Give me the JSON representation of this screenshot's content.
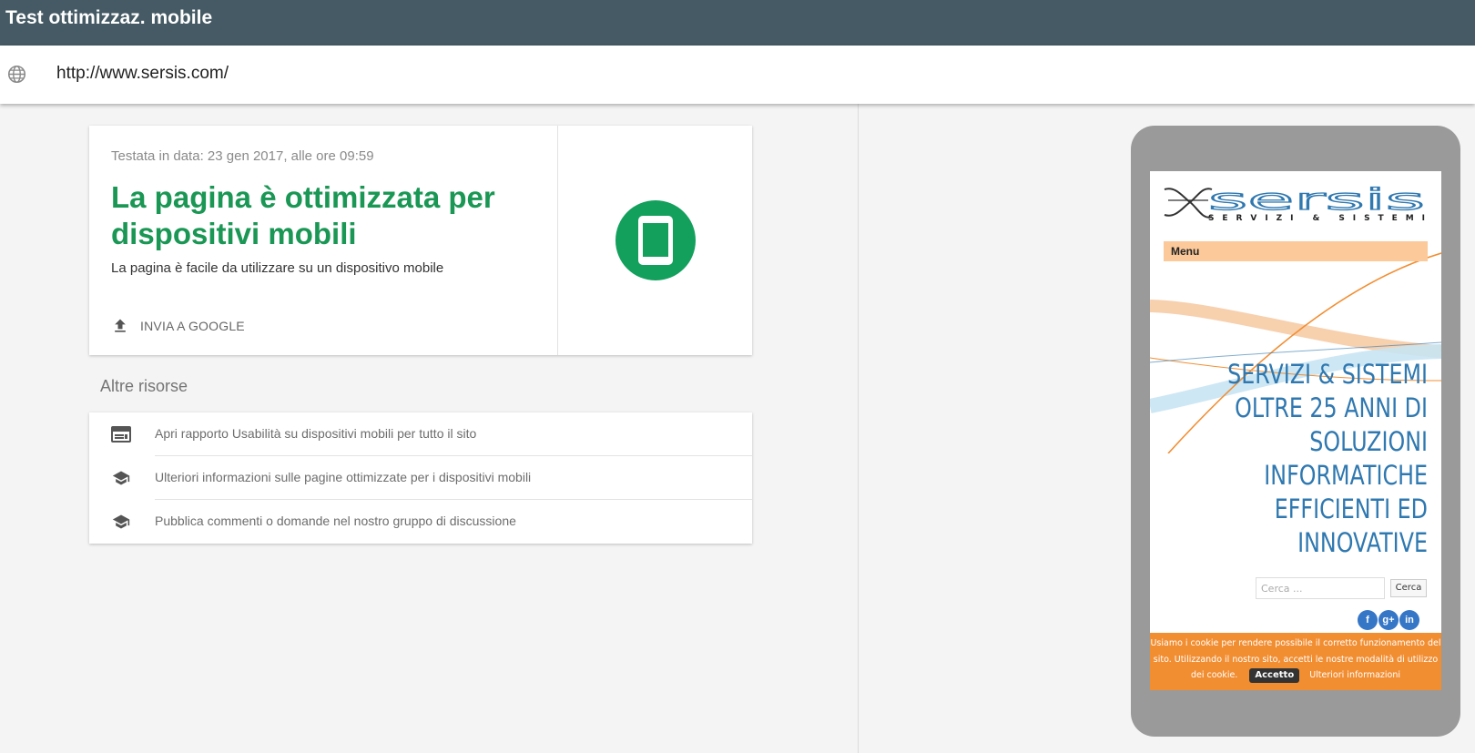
{
  "app": {
    "title": "Test ottimizzaz. mobile"
  },
  "url_bar": {
    "url": "http://www.sersis.com/",
    "icon": "globe-icon"
  },
  "result": {
    "tested_on": "Testata in data: 23 gen 2017, alle ore 09:59",
    "headline_line1": "La pagina è ottimizzata per",
    "headline_line2": "dispositivi mobili",
    "subtitle": "La pagina è facile da utilizzare su un dispositivo mobile",
    "submit_label": "INVIA A GOOGLE",
    "status_icon": "smartphone-icon",
    "accent_color": "#1a9754",
    "badge_color": "#12a05c"
  },
  "resources": {
    "heading": "Altre risorse",
    "items": [
      {
        "label": "Apri rapporto Usabilità su dispositivi mobili per tutto il sito",
        "icon": "browser-window-icon"
      },
      {
        "label": "Ulteriori informazioni sulle pagine ottimizzate per i dispositivi mobili",
        "icon": "school-icon"
      },
      {
        "label": "Pubblica commenti o domande nel nostro gruppo di discussione",
        "icon": "school-icon"
      }
    ]
  },
  "preview": {
    "logo_name": "sersis",
    "logo_tagline": "SERVIZI & SISTEMI",
    "menu_label": "Menu",
    "hero_lines": [
      "SERVIZI & SISTEMI",
      "OLTRE 25 ANNI DI",
      "SOLUZIONI",
      "INFORMATICHE",
      "EFFICIENTI ED",
      "INNOVATIVE"
    ],
    "search_placeholder": "Cerca ...",
    "search_button": "Cerca",
    "social": [
      "f",
      "g+",
      "in"
    ],
    "cookie_line1": "Usiamo i cookie per rendere possibile il corretto funzionamento del",
    "cookie_line2": "sito. Utilizzando il nostro sito, accetti le nostre modalità di utilizzo",
    "cookie_line3": "dei cookie.",
    "cookie_accept": "Accetto",
    "cookie_more": "Ulteriori informazioni"
  }
}
